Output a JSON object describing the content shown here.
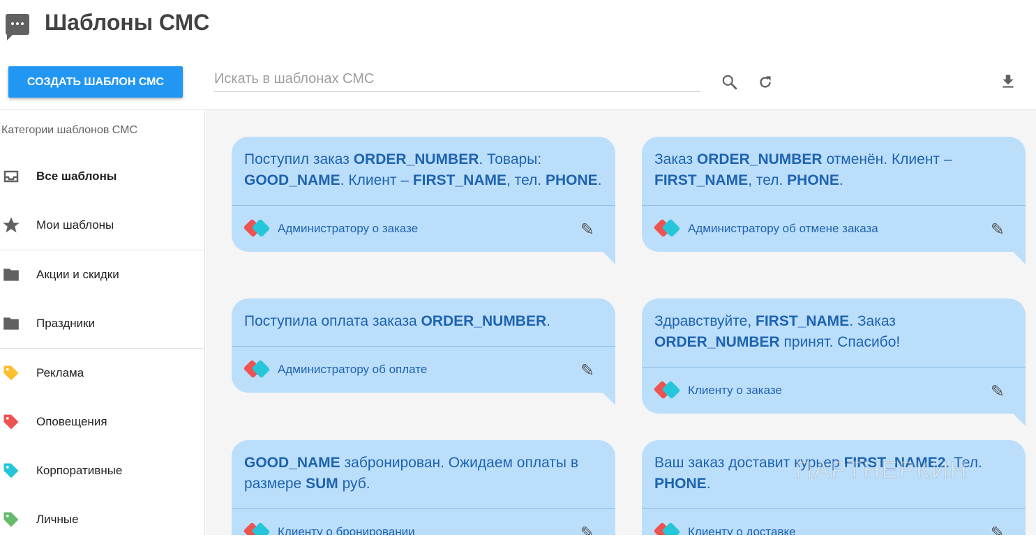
{
  "header": {
    "title": "Шаблоны СМС",
    "create_label": "СОЗДАТЬ ШАБЛОН СМС",
    "search_placeholder": "Искать в шаблонах СМС"
  },
  "sidebar": {
    "heading": "Категории шаблонов СМС",
    "items": [
      {
        "label": "Все шаблоны",
        "icon": "inbox-icon"
      },
      {
        "label": "Мои шаблоны",
        "icon": "star-icon"
      },
      {
        "label": "Акции и скидки",
        "icon": "folder-icon"
      },
      {
        "label": "Праздники",
        "icon": "folder-icon"
      },
      {
        "label": "Реклама",
        "icon": "tag-icon",
        "color": "#fbc02d"
      },
      {
        "label": "Оповещения",
        "icon": "tag-icon",
        "color": "#ef5350"
      },
      {
        "label": "Корпоративные",
        "icon": "tag-icon",
        "color": "#26c6da"
      },
      {
        "label": "Личные",
        "icon": "tag-icon",
        "color": "#66bb6a"
      }
    ]
  },
  "templates": [
    {
      "segments": [
        [
          "Поступил заказ ",
          0
        ],
        [
          "ORDER_NUMBER",
          1
        ],
        [
          ". Товары: ",
          0
        ],
        [
          "GOOD_NAME",
          1
        ],
        [
          ". Клиент – ",
          0
        ],
        [
          "FIRST_NAME",
          1
        ],
        [
          ", тел. ",
          0
        ],
        [
          "PHONE",
          1
        ],
        [
          ".",
          0
        ]
      ],
      "category": "Администратору о заказе"
    },
    {
      "segments": [
        [
          "Заказ ",
          0
        ],
        [
          "ORDER_NUMBER",
          1
        ],
        [
          " отменён. Клиент – ",
          0
        ],
        [
          "FIRST_NAME",
          1
        ],
        [
          ", тел. ",
          0
        ],
        [
          "PHONE",
          1
        ],
        [
          ".",
          0
        ]
      ],
      "category": "Администратору об отмене заказа"
    },
    {
      "segments": [
        [
          "Поступила оплата заказа ",
          0
        ],
        [
          "ORDER_NUMBER",
          1
        ],
        [
          ".",
          0
        ]
      ],
      "category": "Администратору об оплате"
    },
    {
      "segments": [
        [
          "Здравствуйте, ",
          0
        ],
        [
          "FIRST_NAME",
          1
        ],
        [
          ". Заказ ",
          0
        ],
        [
          "ORDER_NUMBER",
          1
        ],
        [
          " принят. Спасибо!",
          0
        ]
      ],
      "category": "Клиенту о заказе"
    },
    {
      "segments": [
        [
          "GOOD_NAME",
          1
        ],
        [
          " забронирован. Ожидаем оплаты в размере ",
          0
        ],
        [
          "SUM",
          1
        ],
        [
          " руб.",
          0
        ]
      ],
      "category": "Клиенту о бронировании"
    },
    {
      "segments": [
        [
          "Ваш заказ доставит курьер ",
          0
        ],
        [
          "FIRST_NAME2",
          1
        ],
        [
          ". Тел. ",
          0
        ],
        [
          "PHONE",
          1
        ],
        [
          ".",
          0
        ]
      ],
      "category": "Клиенту о доставке"
    }
  ],
  "watermark": "ПАРТНЕРКИН"
}
